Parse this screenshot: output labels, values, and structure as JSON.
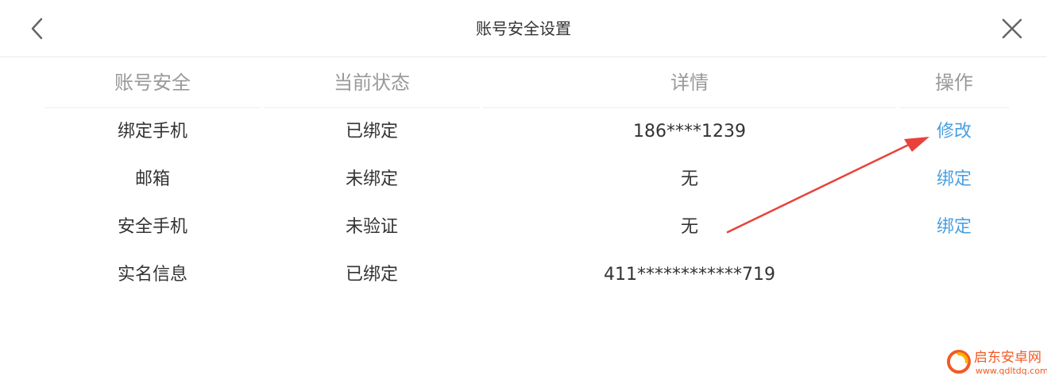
{
  "header": {
    "title": "账号安全设置",
    "back_icon": "chevron-left-icon",
    "close_icon": "close-icon"
  },
  "table": {
    "columns": [
      "账号安全",
      "当前状态",
      "详情",
      "操作"
    ],
    "rows": [
      {
        "item": "绑定手机",
        "status": "已绑定",
        "detail": "186****1239",
        "action": "修改"
      },
      {
        "item": "邮箱",
        "status": "未绑定",
        "detail": "无",
        "action": "绑定"
      },
      {
        "item": "安全手机",
        "status": "未验证",
        "detail": "无",
        "action": "绑定"
      },
      {
        "item": "实名信息",
        "status": "已绑定",
        "detail": "411************719",
        "action": ""
      }
    ]
  },
  "annotation": {
    "type": "arrow",
    "color": "#e8423a",
    "points_to": "修改"
  },
  "watermark": {
    "name": "启东安卓网",
    "url": "www.qdltdq.com",
    "color": "#f15a24"
  },
  "colors": {
    "link": "#4a9fe0",
    "header_text": "#999999",
    "body_text": "#333333"
  }
}
